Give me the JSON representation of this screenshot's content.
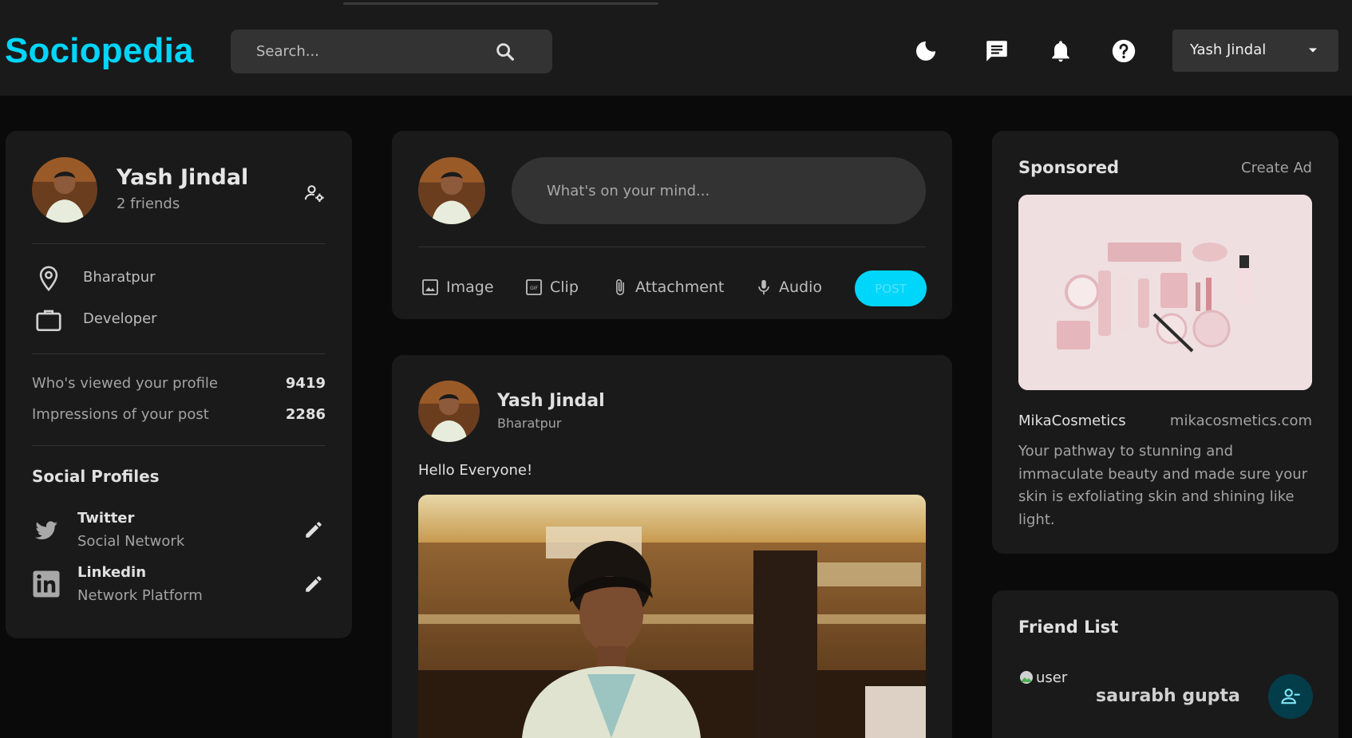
{
  "app": {
    "logo": "Sociopedia"
  },
  "search": {
    "placeholder": "Search..."
  },
  "navbar": {
    "user_name": "Yash Jindal"
  },
  "profile": {
    "name": "Yash Jindal",
    "friends": "2 friends",
    "location": "Bharatpur",
    "occupation": "Developer",
    "stats": [
      {
        "label": "Who's viewed your profile",
        "value": "9419"
      },
      {
        "label": "Impressions of your post",
        "value": "2286"
      }
    ],
    "social_title": "Social Profiles",
    "social": [
      {
        "name": "Twitter",
        "sub": "Social Network"
      },
      {
        "name": "Linkedin",
        "sub": "Network Platform"
      }
    ]
  },
  "composer": {
    "placeholder": "What's on your mind...",
    "actions": {
      "image": "Image",
      "clip": "Clip",
      "attachment": "Attachment",
      "audio": "Audio"
    },
    "post_label": "POST"
  },
  "post": {
    "author": "Yash Jindal",
    "location": "Bharatpur",
    "text": "Hello Everyone!"
  },
  "sponsored": {
    "title": "Sponsored",
    "create_ad": "Create Ad",
    "brand": "MikaCosmetics",
    "url": "mikacosmetics.com",
    "description": "Your pathway to stunning and immaculate beauty and made sure your skin is exfoliating skin and shining like light."
  },
  "friend_list": {
    "title": "Friend List",
    "friends": [
      {
        "alt": "user",
        "name": "saurabh gupta"
      }
    ]
  },
  "colors": {
    "accent": "#00d5fa",
    "card": "#1a1a1a",
    "background": "#0a0a0a"
  }
}
